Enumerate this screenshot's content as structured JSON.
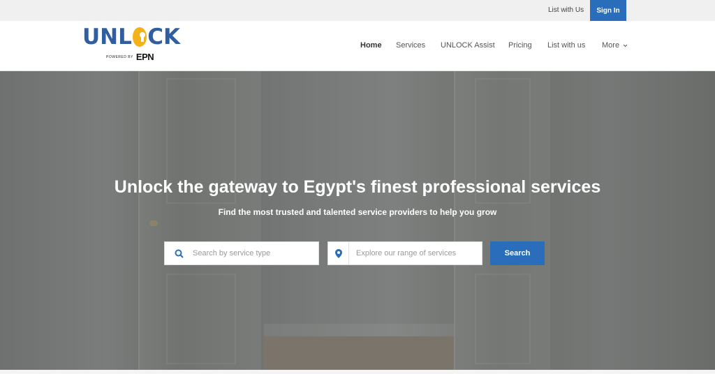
{
  "topbar": {
    "list_with_us": "List with Us",
    "sign_in": "Sign In"
  },
  "logo": {
    "word_left": "UNL",
    "word_right": "CK",
    "powered_by": "POWERED BY",
    "brand": "EPN"
  },
  "nav": {
    "items": [
      {
        "label": "Home",
        "active": true
      },
      {
        "label": "Services"
      },
      {
        "label": "UNLOCK Assist"
      },
      {
        "label": "Pricing"
      },
      {
        "label": "List with us"
      },
      {
        "label": "More"
      }
    ]
  },
  "hero": {
    "title": "Unlock the gateway to Egypt's finest professional services",
    "subtitle": "Find the most trusted and talented service providers to help you grow",
    "service_search": {
      "placeholder": "Search by service type",
      "icon": "search-icon"
    },
    "location_search": {
      "placeholder": "Explore our range of services",
      "icon": "map-pin-icon"
    },
    "search_button": "Search"
  },
  "colors": {
    "accent": "#2a6ebb",
    "logo_blue": "#2f5fa0",
    "logo_yellow": "#f4b21a"
  }
}
